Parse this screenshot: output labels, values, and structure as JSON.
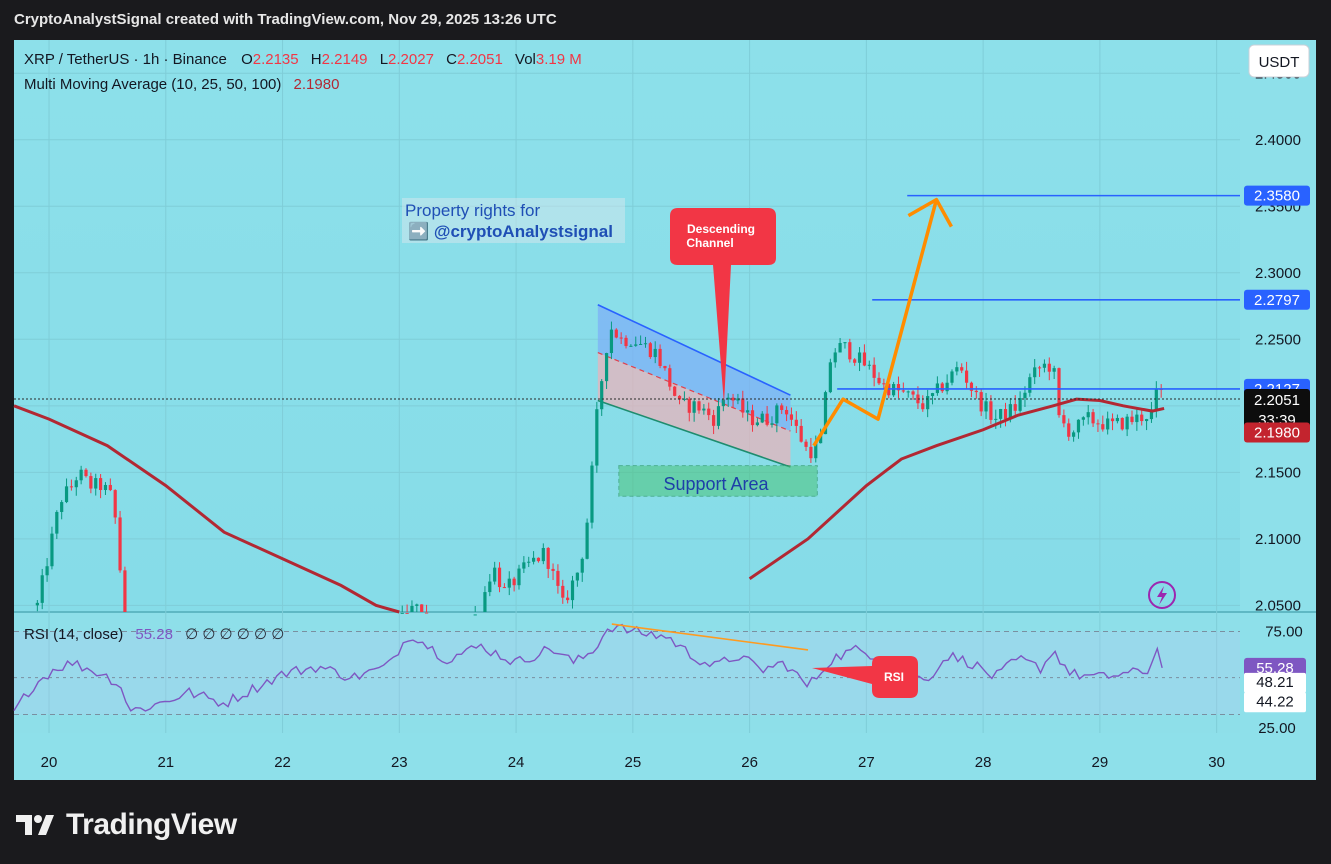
{
  "header": {
    "title": "CryptoAnalystSignal created with TradingView.com, Nov 29, 2025 13:26 UTC"
  },
  "legend": {
    "symbol": "XRP / TetherUS · 1h · Binance",
    "open_label": "O",
    "open": "2.2135",
    "high_label": "H",
    "high": "2.2149",
    "low_label": "L",
    "low": "2.2027",
    "close_label": "C",
    "close": "2.2051",
    "vol_label": "Vol",
    "vol": "3.19 M",
    "ma_label": "Multi Moving Average (10, 25, 50, 100)",
    "ma_value": "2.1980"
  },
  "currency_button": "USDT",
  "annotations": {
    "property_line1": "Property rights for",
    "property_line2": "➡️ @cryptoAnalystsignal",
    "descending_line1": "Descending",
    "descending_line2": "Channel",
    "support": "Support Area",
    "rsi_callout": "RSI"
  },
  "price_tags": {
    "target": "2.3580",
    "resistance": "2.2797",
    "level": "2.2127",
    "current": "2.2051",
    "countdown": "33:39",
    "ma": "2.1980"
  },
  "rsi_panel": {
    "label": "RSI (14, close)",
    "value": "55.28",
    "placeholders": "∅ ∅ ∅ ∅ ∅ ∅",
    "tags": {
      "value": "55.28",
      "upper": "75.00",
      "mid": "48.21",
      "lower": "44.22",
      "hidden": "25.00"
    }
  },
  "footer": {
    "brand": "TradingView"
  },
  "colors": {
    "background": "#8de0ea",
    "up": "#089981",
    "down": "#f23645",
    "ma": "#b22833",
    "level": "#2962ff",
    "projection": "#ff8c00",
    "rsi": "#7e57c2"
  },
  "chart_data": {
    "type": "candlestick",
    "title": "XRP / TetherUS · 1h · Binance",
    "y_axis": {
      "range": [
        2.045,
        2.475
      ],
      "ticks": [
        "2.0500",
        "2.1000",
        "2.1500",
        "2.2000",
        "2.2500",
        "2.3000",
        "2.3500",
        "2.4000",
        "2.4500"
      ]
    },
    "x_axis": {
      "range": [
        19.7,
        30.2
      ],
      "ticks": [
        "20",
        "21",
        "22",
        "23",
        "24",
        "25",
        "26",
        "27",
        "28",
        "29",
        "30"
      ]
    },
    "ohlc_waypoints": [
      [
        19.9,
        2.05
      ],
      [
        20.0,
        2.09
      ],
      [
        20.1,
        2.13
      ],
      [
        20.2,
        2.14
      ],
      [
        20.25,
        2.15
      ],
      [
        20.35,
        2.14
      ],
      [
        20.45,
        2.14
      ],
      [
        20.55,
        2.13
      ],
      [
        20.65,
        2.04
      ],
      [
        20.9,
        2.01
      ],
      [
        21.5,
        2.0
      ],
      [
        22.5,
        1.99
      ],
      [
        23.15,
        2.05
      ],
      [
        23.4,
        2.0
      ],
      [
        23.7,
        2.05
      ],
      [
        23.8,
        2.08
      ],
      [
        23.9,
        2.06
      ],
      [
        24.1,
        2.08
      ],
      [
        24.25,
        2.09
      ],
      [
        24.4,
        2.05
      ],
      [
        24.55,
        2.08
      ],
      [
        24.62,
        2.12
      ],
      [
        24.7,
        2.2
      ],
      [
        24.8,
        2.26
      ],
      [
        24.9,
        2.25
      ],
      [
        25.0,
        2.25
      ],
      [
        25.2,
        2.24
      ],
      [
        25.4,
        2.2
      ],
      [
        25.55,
        2.2
      ],
      [
        25.7,
        2.19
      ],
      [
        25.8,
        2.21
      ],
      [
        26.0,
        2.19
      ],
      [
        26.15,
        2.19
      ],
      [
        26.3,
        2.2
      ],
      [
        26.5,
        2.165
      ],
      [
        26.6,
        2.17
      ],
      [
        26.7,
        2.24
      ],
      [
        26.8,
        2.245
      ],
      [
        27.0,
        2.23
      ],
      [
        27.15,
        2.215
      ],
      [
        27.3,
        2.21
      ],
      [
        27.5,
        2.2
      ],
      [
        27.7,
        2.22
      ],
      [
        27.8,
        2.23
      ],
      [
        27.95,
        2.205
      ],
      [
        28.1,
        2.19
      ],
      [
        28.3,
        2.2
      ],
      [
        28.4,
        2.22
      ],
      [
        28.5,
        2.23
      ],
      [
        28.6,
        2.23
      ],
      [
        28.65,
        2.19
      ],
      [
        28.75,
        2.18
      ],
      [
        28.9,
        2.19
      ],
      [
        29.1,
        2.185
      ],
      [
        29.3,
        2.19
      ],
      [
        29.45,
        2.195
      ],
      [
        29.5,
        2.214
      ],
      [
        29.55,
        2.2051
      ]
    ],
    "moving_average_100": [
      [
        19.7,
        2.2
      ],
      [
        20.0,
        2.19
      ],
      [
        20.5,
        2.17
      ],
      [
        21.0,
        2.14
      ],
      [
        21.5,
        2.105
      ],
      [
        22.0,
        2.085
      ],
      [
        22.5,
        2.065
      ],
      [
        22.8,
        2.05
      ],
      [
        23.0,
        2.04
      ],
      [
        24.0,
        1.98
      ],
      [
        25.0,
        2.0
      ],
      [
        25.5,
        2.035
      ],
      [
        26.0,
        2.07
      ],
      [
        26.5,
        2.1
      ],
      [
        27.0,
        2.14
      ],
      [
        27.3,
        2.16
      ],
      [
        27.6,
        2.17
      ],
      [
        28.0,
        2.182
      ],
      [
        28.3,
        2.193
      ],
      [
        28.6,
        2.2
      ],
      [
        28.8,
        2.205
      ],
      [
        29.0,
        2.204
      ],
      [
        29.2,
        2.2
      ],
      [
        29.45,
        2.196
      ],
      [
        29.55,
        2.198
      ]
    ],
    "descending_channel": {
      "upper": [
        [
          24.7,
          2.276
        ],
        [
          26.35,
          2.208
        ]
      ],
      "lower": [
        [
          24.7,
          2.204
        ],
        [
          26.35,
          2.154
        ]
      ]
    },
    "support_area": {
      "x": [
        24.88,
        26.58
      ],
      "y": [
        2.132,
        2.155
      ]
    },
    "projection_path": [
      [
        26.55,
        2.17
      ],
      [
        26.8,
        2.205
      ],
      [
        27.1,
        2.19
      ],
      [
        27.6,
        2.355
      ]
    ],
    "levels": [
      {
        "price": 2.358,
        "from": 27.35
      },
      {
        "price": 2.2797,
        "from": 27.05
      },
      {
        "price": 2.2127,
        "from": 26.75
      }
    ],
    "rsi_series": {
      "range": [
        20,
        85
      ],
      "ticks": [
        "75.00"
      ],
      "waypoints": [
        [
          19.7,
          31
        ],
        [
          19.85,
          45
        ],
        [
          20.05,
          55
        ],
        [
          20.2,
          58
        ],
        [
          20.45,
          52
        ],
        [
          20.6,
          47
        ],
        [
          20.7,
          32
        ],
        [
          20.9,
          35
        ],
        [
          21.2,
          42
        ],
        [
          21.5,
          36
        ],
        [
          22.0,
          52
        ],
        [
          22.3,
          56
        ],
        [
          22.6,
          50
        ],
        [
          22.9,
          56
        ],
        [
          23.0,
          66
        ],
        [
          23.1,
          74
        ],
        [
          23.4,
          60
        ],
        [
          23.7,
          67
        ],
        [
          24.0,
          58
        ],
        [
          24.3,
          66
        ],
        [
          24.5,
          58
        ],
        [
          24.65,
          64
        ],
        [
          24.8,
          78
        ],
        [
          25.0,
          75
        ],
        [
          25.3,
          72
        ],
        [
          25.5,
          62
        ],
        [
          25.7,
          56
        ],
        [
          25.9,
          62
        ],
        [
          26.1,
          54
        ],
        [
          26.3,
          58
        ],
        [
          26.5,
          45
        ],
        [
          26.7,
          60
        ],
        [
          26.9,
          65
        ],
        [
          27.1,
          62
        ],
        [
          27.3,
          55
        ],
        [
          27.5,
          48
        ],
        [
          27.7,
          62
        ],
        [
          27.9,
          58
        ],
        [
          28.1,
          50
        ],
        [
          28.3,
          60
        ],
        [
          28.5,
          55
        ],
        [
          28.6,
          65
        ],
        [
          28.75,
          52
        ],
        [
          29.0,
          50
        ],
        [
          29.2,
          52
        ],
        [
          29.4,
          53
        ],
        [
          29.5,
          66
        ],
        [
          29.55,
          63
        ]
      ],
      "divergence_line": [
        [
          24.82,
          79
        ],
        [
          26.5,
          65
        ]
      ],
      "callout_tip": [
        26.55,
        53
      ]
    }
  }
}
